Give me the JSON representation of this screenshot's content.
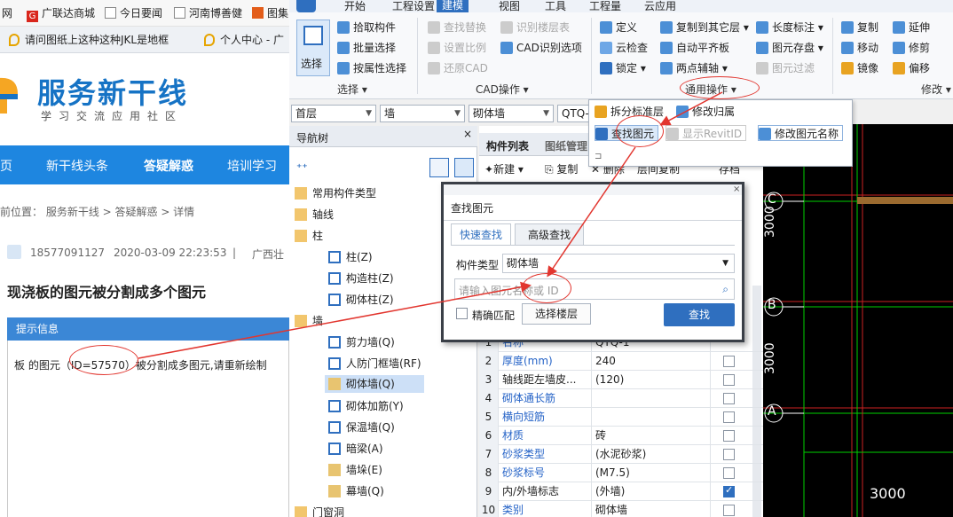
{
  "browser": {
    "bookmarks": [
      "网",
      "广联达商城",
      "今日要闻",
      "河南博善健",
      "图集"
    ],
    "tabs": [
      "请问图纸上这种这种JKL是地框",
      "个人中心 - 广"
    ],
    "site": {
      "title": "服务新干线",
      "subtitle": "学习交流应用社区"
    },
    "nav": [
      "页",
      "新干线头条",
      "答疑解惑",
      "培训学习"
    ],
    "breadcrumb": "前位置： 服务新干线 > 答疑解惑 > 详情",
    "post": {
      "user": "18577091127",
      "time": "2020-03-09 22:23:53",
      "sep": "|",
      "region": "广西壮",
      "title": "现浇板的图元被分割成多个图元"
    },
    "tip": {
      "header": "提示信息",
      "text": "板 的图元（ID=57570）被分割成多图元,请重新绘制"
    }
  },
  "app": {
    "menu": [
      "开始",
      "工程设置",
      "建模",
      "视图",
      "工具",
      "工程量",
      "云应用"
    ],
    "active_menu": "建模",
    "ribbon": {
      "select_big": "选择",
      "select_items": [
        "拾取构件",
        "批量选择",
        "按属性选择"
      ],
      "select_group": "选择",
      "cad_items": [
        "查找替换",
        "识别楼层表",
        "设置比例",
        "CAD识别选项",
        "还原CAD"
      ],
      "cad_group": "CAD操作",
      "common_items": [
        "定义",
        "复制到其它层",
        "长度标注",
        "云检查",
        "自动平齐板",
        "图元存盘",
        "锁定",
        "两点辅轴",
        "图元过滤"
      ],
      "common_group": "通用操作",
      "modify_items": [
        "复制",
        "延伸",
        "移动",
        "修剪",
        "镜像",
        "偏移"
      ],
      "modify_group": "修改"
    },
    "dropdown": {
      "items": [
        "拆分标准层",
        "修改归属",
        "查找图元",
        "显示RevitID",
        "修改图元名称"
      ]
    },
    "combos": [
      "首层",
      "墙",
      "砌体墙",
      "QTQ-"
    ],
    "tree": {
      "title": "导航树",
      "nodes": [
        "常用构件类型",
        "轴线",
        "柱",
        "柱(Z)",
        "构造柱(Z)",
        "砌体柱(Z)",
        "墙",
        "剪力墙(Q)",
        "人防门框墙(RF)",
        "砌体墙(Q)",
        "砌体加筋(Y)",
        "保温墙(Q)",
        "暗梁(A)",
        "墙垛(E)",
        "幕墙(Q)",
        "门窗洞"
      ]
    },
    "comp": {
      "tabs": [
        "构件列表",
        "图纸管理"
      ],
      "tools": [
        "新建",
        "复制",
        "删除",
        "层间复制",
        "存档"
      ]
    },
    "props": [
      {
        "no": "1",
        "name": "名称",
        "value": "QTQ-1",
        "blue": true,
        "check": null
      },
      {
        "no": "2",
        "name": "厚度(mm)",
        "value": "240",
        "blue": true,
        "check": false
      },
      {
        "no": "3",
        "name": "轴线距左墙皮...",
        "value": "(120)",
        "blue": false,
        "check": false
      },
      {
        "no": "4",
        "name": "砌体通长筋",
        "value": "",
        "blue": true,
        "check": false
      },
      {
        "no": "5",
        "name": "横向短筋",
        "value": "",
        "blue": true,
        "check": false
      },
      {
        "no": "6",
        "name": "材质",
        "value": "砖",
        "blue": true,
        "check": false
      },
      {
        "no": "7",
        "name": "砂浆类型",
        "value": "(水泥砂浆)",
        "blue": true,
        "check": false
      },
      {
        "no": "8",
        "name": "砂浆标号",
        "value": "(M7.5)",
        "blue": true,
        "check": false
      },
      {
        "no": "9",
        "name": "内/外墙标志",
        "value": "(外墙)",
        "blue": false,
        "check": true
      },
      {
        "no": "10",
        "name": "类别",
        "value": "砌体墙",
        "blue": true,
        "check": false
      }
    ],
    "find_dialog": {
      "title": "查找图元",
      "tabs": [
        "快速查找",
        "高级查找"
      ],
      "type_label": "构件类型",
      "type_value": "砌体墙",
      "search_placeholder": "请输入图元名称或 ID",
      "exact_label": "精确匹配",
      "floor_button": "选择楼层",
      "find_button": "查找"
    },
    "cad": {
      "axes": [
        "C",
        "B",
        "A"
      ],
      "dims": [
        "3000",
        "3000",
        "3000"
      ]
    }
  },
  "colors": {
    "brand_blue": "#1e86e0",
    "accent_blue": "#2f6fbf",
    "annotation_red": "#e2362f",
    "cad_green": "#00d000"
  }
}
